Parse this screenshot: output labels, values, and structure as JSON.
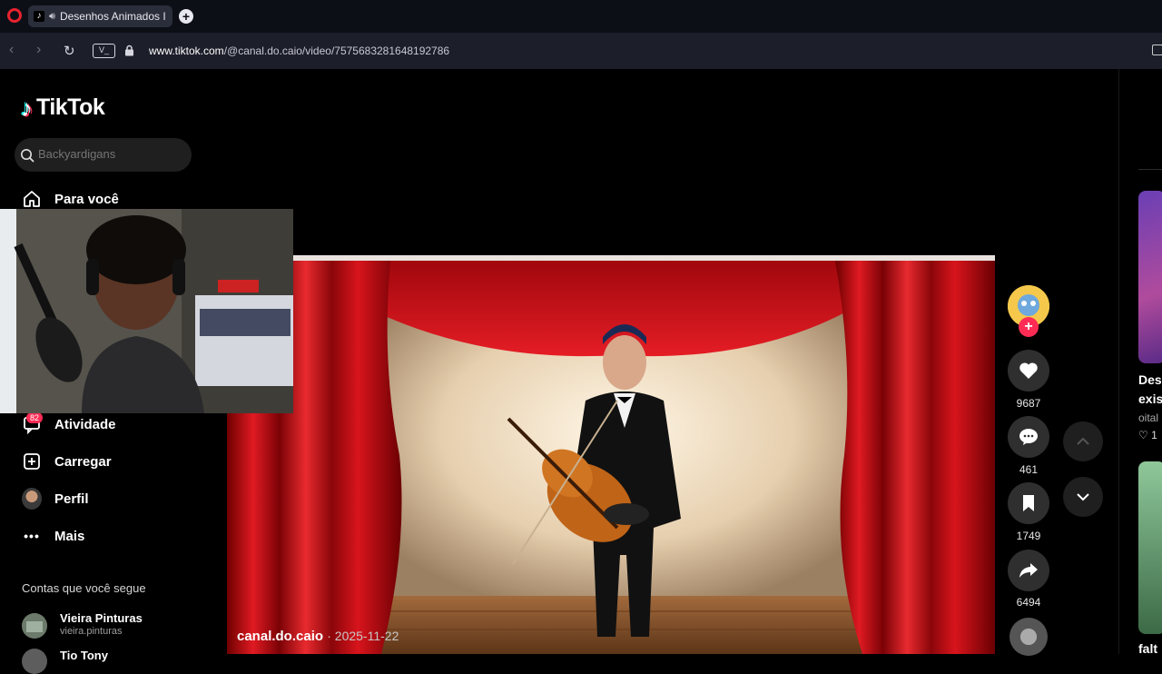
{
  "browser": {
    "tab_title": "Desenhos Animados I",
    "url_domain": "www.tiktok.com",
    "url_path": "/@canal.do.caio/video/7575683281648192786",
    "vpn_label": "V_"
  },
  "sidebar": {
    "logo_text": "TikTok",
    "search_placeholder": "Backyardigans",
    "nav": {
      "for_you": "Para você",
      "activity": "Atividade",
      "activity_badge": "82",
      "upload": "Carregar",
      "profile": "Perfil",
      "more": "Mais"
    },
    "following_title": "Contas que você segue",
    "accounts": [
      {
        "name": "Vieira Pinturas",
        "handle": "vieira.pinturas"
      },
      {
        "name": "Tio Tony"
      }
    ]
  },
  "video": {
    "creator": "canal.do.caio",
    "date": "2025-11-22"
  },
  "actions": {
    "likes": "9687",
    "comments": "461",
    "saves": "1749",
    "shares": "6494"
  },
  "right_column": {
    "title1_line1": "Des",
    "title1_line2": "exis",
    "author": "oital",
    "likes": "1",
    "title2": "falt"
  },
  "colors": {
    "tiktok_red": "#fe2c55",
    "tiktok_cyan": "#25f4ee",
    "curtain_red": "#c8101a",
    "opera_red": "#e8232f"
  },
  "icons": [
    "opera-logo-icon",
    "speaker-icon",
    "tiktok-favicon-icon",
    "plus-icon",
    "back-icon",
    "forward-icon",
    "reload-icon",
    "lock-icon",
    "search-icon",
    "home-icon",
    "activity-icon",
    "upload-icon",
    "more-icon",
    "heart-icon",
    "comment-icon",
    "bookmark-icon",
    "share-icon",
    "chevron-up-icon",
    "chevron-down-icon"
  ]
}
